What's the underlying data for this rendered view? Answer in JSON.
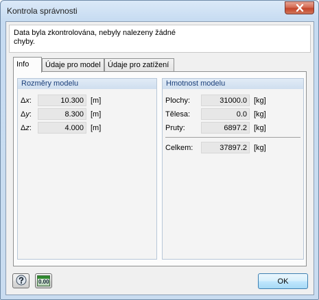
{
  "window": {
    "title": "Kontrola správnosti"
  },
  "message": "Data byla zkontrolována, nebyly nalezeny žádné chyby.",
  "tabs": [
    {
      "label": "Info",
      "active": true
    },
    {
      "label": "Údaje pro model",
      "active": false
    },
    {
      "label": "Údaje pro zatížení",
      "active": false
    }
  ],
  "dimensions": {
    "title": "Rozměry modelu",
    "rows": [
      {
        "delta": "Δ",
        "axis": "x",
        "colon": ":",
        "value": "10.300",
        "unit": "[m]"
      },
      {
        "delta": "Δ",
        "axis": "y",
        "colon": ":",
        "value": "8.300",
        "unit": "[m]"
      },
      {
        "delta": "Δ",
        "axis": "z",
        "colon": ":",
        "value": "4.000",
        "unit": "[m]"
      }
    ]
  },
  "mass": {
    "title": "Hmotnost modelu",
    "rows": [
      {
        "label": "Plochy:",
        "value": "31000.0",
        "unit": "[kg]"
      },
      {
        "label": "Tělesa:",
        "value": "0.0",
        "unit": "[kg]"
      },
      {
        "label": "Pruty:",
        "value": "6897.2",
        "unit": "[kg]"
      }
    ],
    "total": {
      "label": "Celkem:",
      "value": "37897.2",
      "unit": "[kg]"
    }
  },
  "buttons": {
    "ok": "OK",
    "help_icon": "help-icon",
    "units_icon": "decimal-places-icon",
    "units_icon_text": "0.00"
  },
  "colors": {
    "group_header_text": "#1a3f7a",
    "close_button": "#c4452b"
  }
}
